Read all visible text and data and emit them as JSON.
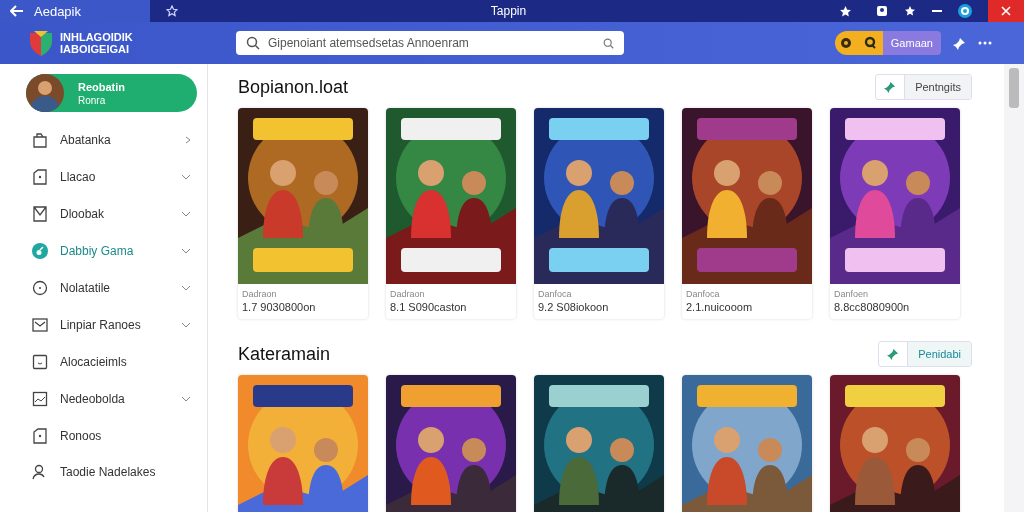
{
  "title_bar": {
    "tab_label": "Aedapik",
    "title": "Tappin"
  },
  "header": {
    "logo_lines": [
      "INHLAGOIDIK",
      "IABOIGEIGAI"
    ],
    "search": {
      "placeholder": "Gipenoiant atemsedsetas Annoenram"
    },
    "button": "Gamaan"
  },
  "sidebar": {
    "profile": {
      "name": "Reobatin",
      "subtitle": "Ronra"
    },
    "items": [
      {
        "label": "Abatanka",
        "selected": false
      },
      {
        "label": "Llacao",
        "selected": false
      },
      {
        "label": "Dloobak",
        "selected": false
      },
      {
        "label": "Dabbiy Gama",
        "selected": true
      },
      {
        "label": "Nolatatile",
        "selected": false
      },
      {
        "label": "Linpiar Ranoes",
        "selected": false
      },
      {
        "label": "Alocacieimls",
        "selected": false
      },
      {
        "label": "Nedeobolda",
        "selected": false
      },
      {
        "label": "Ronoos",
        "selected": false
      },
      {
        "label": "Taodie Nadelakes",
        "selected": false
      }
    ]
  },
  "sections": [
    {
      "title": "Bopianon.loat",
      "button": "Pentngits",
      "cards": [
        {
          "kind": "picture",
          "label": "Dadraon",
          "price": "1.7 9030800on"
        },
        {
          "kind": "picture",
          "label": "Dadraon",
          "price": "8.1 S090caston"
        },
        {
          "kind": "picture",
          "label": "Danfoca",
          "price": "9.2 S08iokoon"
        },
        {
          "kind": "picture",
          "label": "Danfoca",
          "price": "2.1.nuicooom"
        },
        {
          "kind": "picture",
          "label": "Danfoen",
          "price": "8.8cc8080900n"
        }
      ]
    },
    {
      "title": "Kateramain",
      "button": "Penidabi"
    }
  ]
}
